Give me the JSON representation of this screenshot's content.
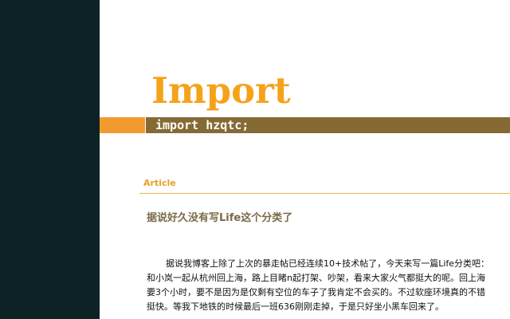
{
  "site": {
    "title": "Import",
    "tagline": "import hzqtc;"
  },
  "section": {
    "label": "Article"
  },
  "post": {
    "title": "据说好久没有写Life这个分类了",
    "lines": [
      "据说我博客上除了上次的暴走帖已经连续10+技术帖了，今天来写一篇Life分类吧：",
      "和小岚一起从杭州回上海，路上目睹n起打架、吵架，看来大家火气都挺大的呢。回上海",
      "要3个小时，要不是因为是仅剩有空位的车子了我肯定不会买的。不过软座环境真的不错",
      "挺快。等我下地铁的时候最后一班636刚刚走掉，于是只好坐小黑车回来了。"
    ]
  },
  "colors": {
    "sidebar": "#0c2224",
    "title": "#f5a21b",
    "tab_orange": "#f29a2e",
    "tagline_bar": "#856a34",
    "section_label": "#e9a027",
    "post_title": "#7a6a48"
  }
}
